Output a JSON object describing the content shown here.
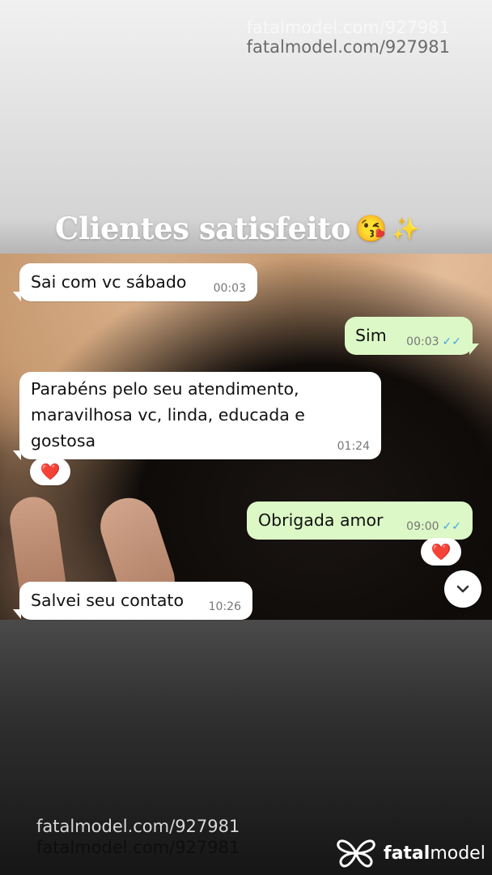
{
  "watermark": {
    "top": "fatalmodel.com/927981",
    "bottom": "fatalmodel.com/927981"
  },
  "headline": {
    "text": "Clientes satisfeito",
    "emoji_kiss": "😘",
    "emoji_sparkles": "✨"
  },
  "messages": [
    {
      "direction": "in",
      "text": "Sai com vc sábado",
      "time": "00:03"
    },
    {
      "direction": "out",
      "text": "Sim",
      "time": "00:03"
    },
    {
      "direction": "in",
      "text": "Parabéns pelo seu atendimento, maravilhosa vc, linda, educada e gostosa",
      "time": "01:24",
      "reaction": "❤️"
    },
    {
      "direction": "out",
      "text": "Obrigada amor",
      "time": "09:00",
      "reaction": "❤️"
    },
    {
      "direction": "in",
      "text": "Salvei seu contato",
      "time": "10:26"
    }
  ],
  "logo": {
    "brand_prefix": "fatal",
    "brand_suffix": "model"
  },
  "colors": {
    "outgoing_bubble": "#dcf8c6",
    "incoming_bubble": "#ffffff",
    "read_ticks": "#3fa6e6"
  },
  "icons": {
    "read_receipt": "double-check-icon",
    "scroll_down": "chevron-down-icon",
    "reaction": "heart-icon"
  }
}
